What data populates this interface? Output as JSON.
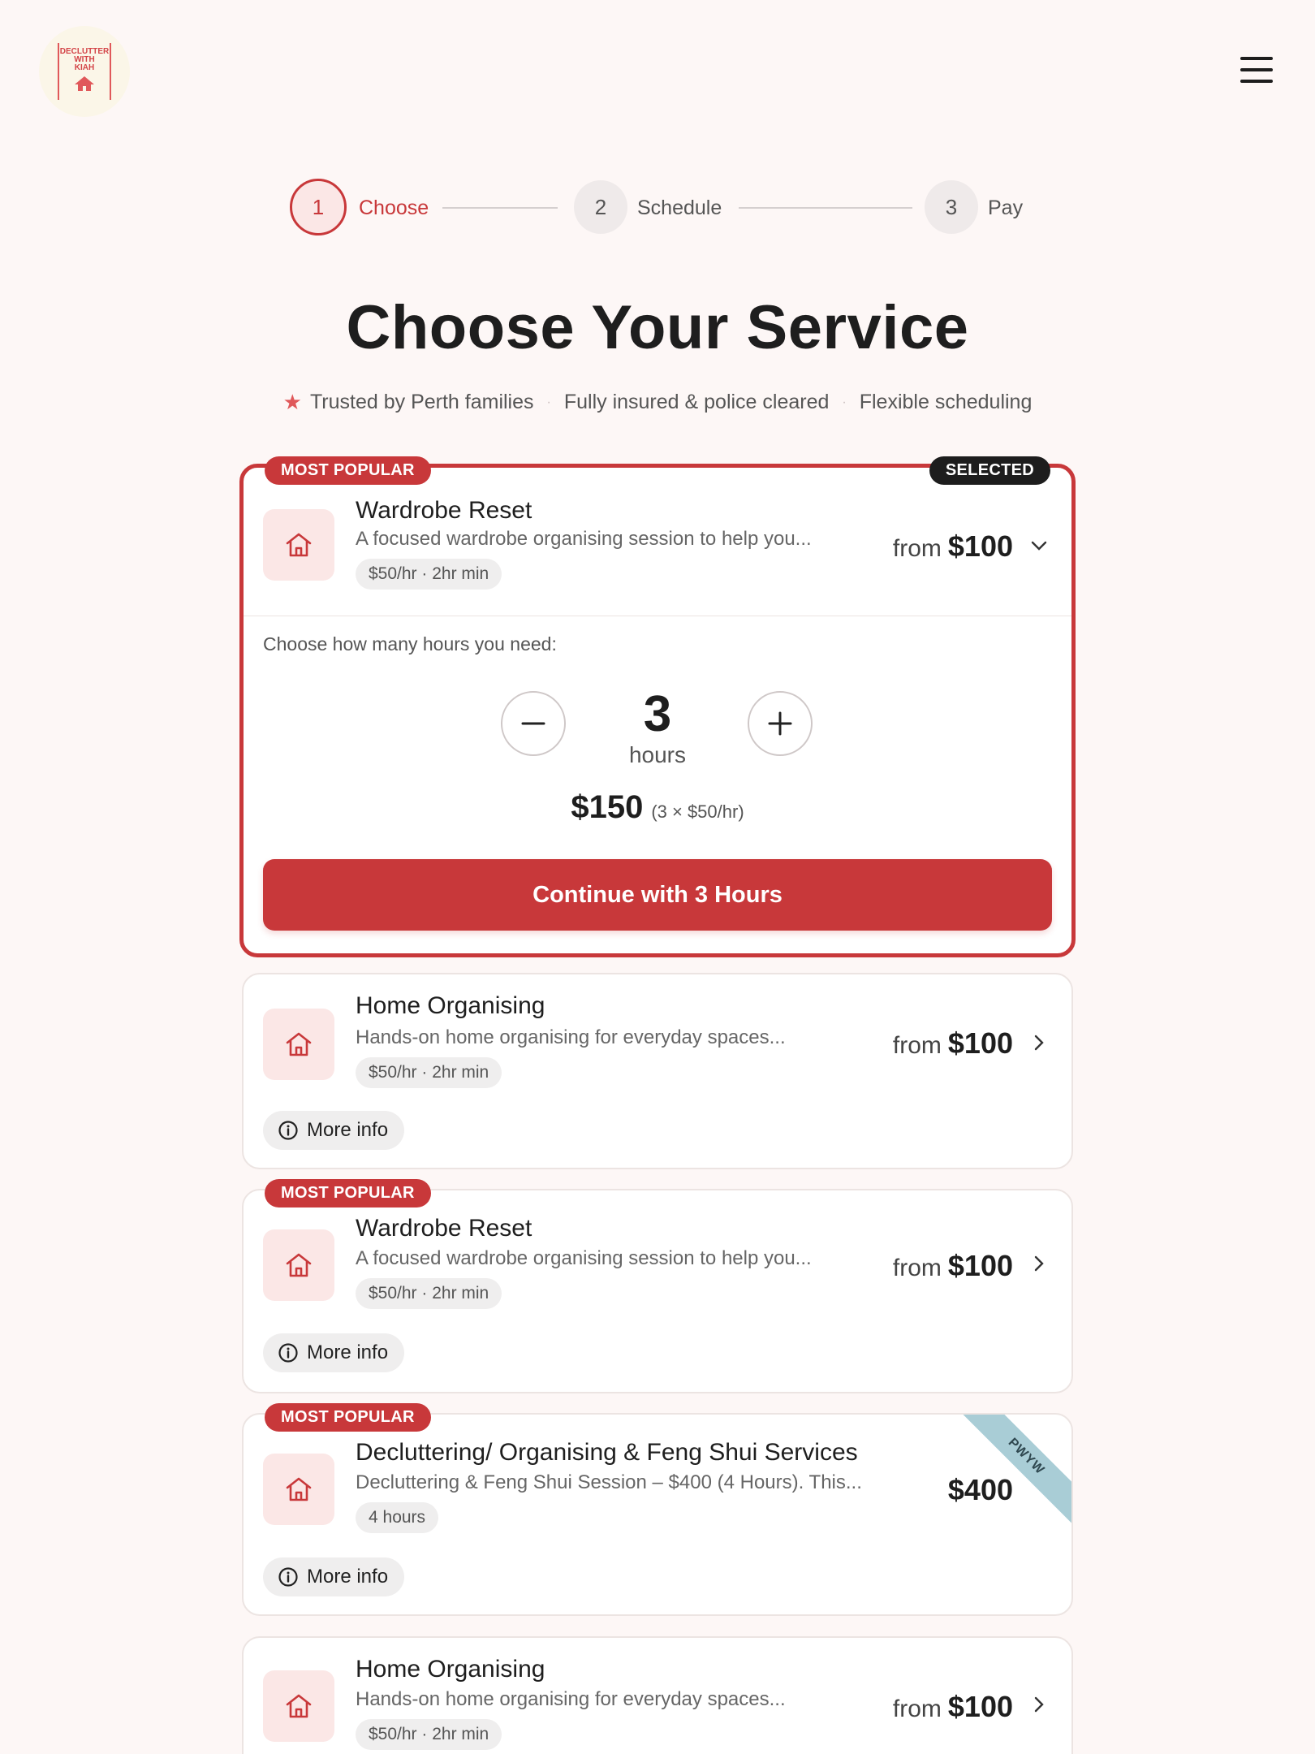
{
  "header": {
    "logo_lines": [
      "DECLUTTER",
      "WITH",
      "KIAH"
    ],
    "menu_icon": "hamburger-icon"
  },
  "steps": [
    {
      "number": "1",
      "label": "Choose",
      "state": "active"
    },
    {
      "number": "2",
      "label": "Schedule",
      "state": "inactive"
    },
    {
      "number": "3",
      "label": "Pay",
      "state": "inactive"
    }
  ],
  "page": {
    "title": "Choose Your Service",
    "trust": [
      "Trusted by Perth families",
      "Fully insured & police cleared",
      "Flexible scheduling"
    ]
  },
  "selected_card": {
    "popular_badge": "MOST POPULAR",
    "selected_badge": "SELECTED",
    "name": "Wardrobe Reset",
    "description": "A focused wardrobe organising session to help you...",
    "tag": "$50/hr · 2hr min",
    "price_prefix": "from",
    "price": "$100",
    "hours_prompt": "Choose how many hours you need:",
    "hours_value": "3",
    "hours_unit": "hours",
    "total": "$150",
    "total_calc": "(3 × $50/hr)",
    "continue_label": "Continue with 3 Hours"
  },
  "services": [
    {
      "popular": "",
      "name": "Home Organising",
      "description": "Hands-on home organising for everyday spaces...",
      "tag": "$50/hr · 2hr min",
      "price_prefix": "from",
      "price": "$100",
      "more_info": "More info",
      "ribbon": ""
    },
    {
      "popular": "MOST POPULAR",
      "name": "Wardrobe Reset",
      "description": "A focused wardrobe organising session to help you...",
      "tag": "$50/hr · 2hr min",
      "price_prefix": "from",
      "price": "$100",
      "more_info": "More info",
      "ribbon": ""
    },
    {
      "popular": "MOST POPULAR",
      "name": "Decluttering/ Organising & Feng Shui Services",
      "description": "Decluttering & Feng Shui Session – $400 (4 Hours). This...",
      "tag": "4 hours",
      "price_prefix": "",
      "price": "$400",
      "more_info": "More info",
      "ribbon": "PWYW"
    },
    {
      "popular": "",
      "name": "Home Organising",
      "description": "Hands-on home organising for everyday spaces...",
      "tag": "$50/hr · 2hr min",
      "price_prefix": "from",
      "price": "$100",
      "more_info": "",
      "ribbon": ""
    }
  ],
  "colors": {
    "accent": "#c8383a",
    "background": "#fdf7f6",
    "icon_bg": "#fbe7e6",
    "ribbon": "#a9cdd6"
  }
}
